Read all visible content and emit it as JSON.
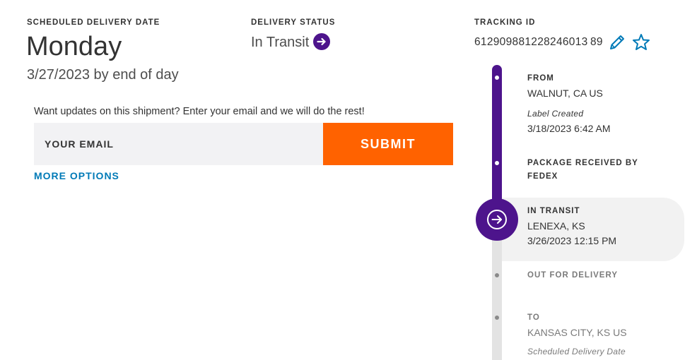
{
  "scheduled_delivery": {
    "label": "SCHEDULED DELIVERY DATE",
    "day": "Monday",
    "date_line": "3/27/2023 by end of day"
  },
  "delivery_status": {
    "label": "DELIVERY STATUS",
    "value": "In Transit",
    "icon": "arrow-right-circle-icon"
  },
  "tracking": {
    "label": "TRACKING ID",
    "number": "612909881228246013 89",
    "actions": [
      "pencil-icon",
      "star-icon"
    ]
  },
  "email_updates": {
    "prompt": "Want updates on this shipment? Enter your email and we will do the rest!",
    "input_placeholder": "YOUR EMAIL",
    "input_value": "",
    "submit_label": "SUBMIT",
    "more_options_label": "MORE OPTIONS"
  },
  "timeline": {
    "from": {
      "title": "FROM",
      "location": "WALNUT, CA US",
      "note": "Label Created",
      "datetime": "3/18/2023 6:42 AM"
    },
    "received": {
      "title_line1": "PACKAGE RECEIVED BY",
      "title_line2": "FEDEX"
    },
    "current": {
      "title": "IN TRANSIT",
      "location": "LENEXA, KS",
      "datetime": "3/26/2023 12:15 PM"
    },
    "out_for_delivery": {
      "title": "OUT FOR DELIVERY"
    },
    "to": {
      "title": "TO",
      "location": "KANSAS CITY, KS US",
      "note": "Scheduled Delivery Date"
    }
  },
  "colors": {
    "brand_purple": "#4d148c",
    "brand_orange": "#ff6200",
    "link_blue": "#007ab7",
    "field_gray": "#f2f2f4"
  }
}
